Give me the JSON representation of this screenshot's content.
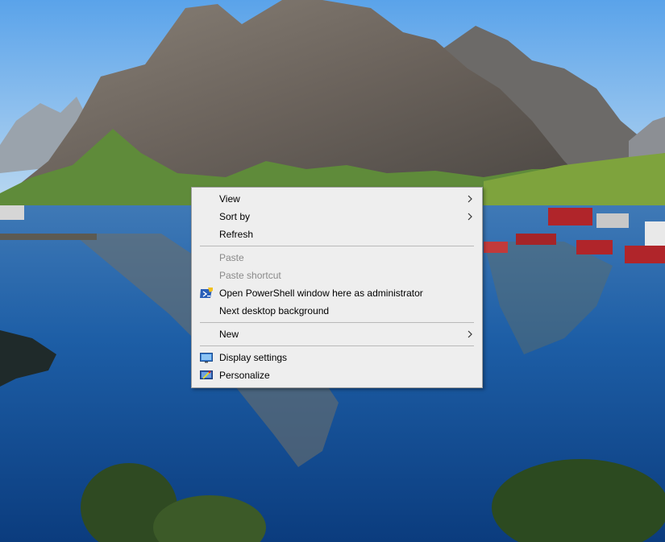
{
  "context_menu": {
    "groups": [
      {
        "items": [
          {
            "label": "View",
            "submenu": true,
            "enabled": true
          },
          {
            "label": "Sort by",
            "submenu": true,
            "enabled": true
          },
          {
            "label": "Refresh",
            "submenu": false,
            "enabled": true
          }
        ]
      },
      {
        "items": [
          {
            "label": "Paste",
            "submenu": false,
            "enabled": false
          },
          {
            "label": "Paste shortcut",
            "submenu": false,
            "enabled": false
          },
          {
            "label": "Open PowerShell window here as administrator",
            "submenu": false,
            "enabled": true,
            "icon": "powershell-admin-icon"
          },
          {
            "label": "Next desktop background",
            "submenu": false,
            "enabled": true
          }
        ]
      },
      {
        "items": [
          {
            "label": "New",
            "submenu": true,
            "enabled": true
          }
        ]
      },
      {
        "items": [
          {
            "label": "Display settings",
            "submenu": false,
            "enabled": true,
            "icon": "display-settings-icon"
          },
          {
            "label": "Personalize",
            "submenu": false,
            "enabled": true,
            "icon": "personalize-icon"
          }
        ]
      }
    ]
  },
  "colors": {
    "menu_background": "#eeeeee",
    "menu_border": "#a0a0a0",
    "disabled_text": "#8a8a8a",
    "separator": "#b9b9b9"
  }
}
